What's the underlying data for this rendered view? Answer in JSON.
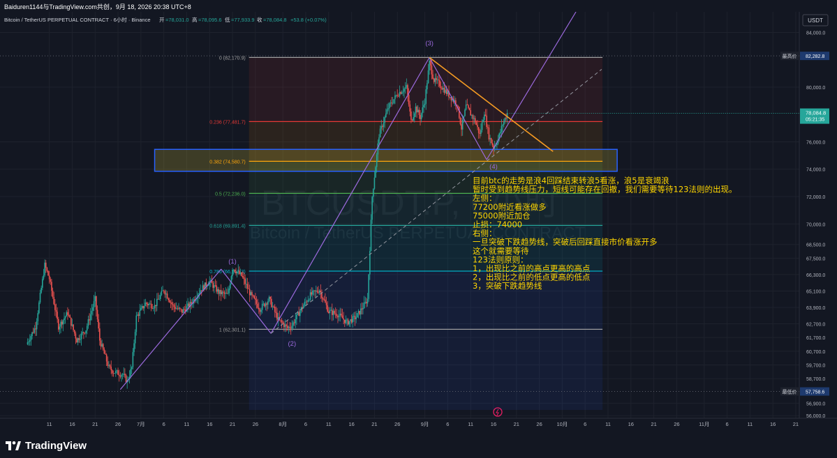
{
  "header": {
    "attribution": "Baiduren1144与TradingView.com共创，9月 18, 2026 20:38 UTC+8",
    "symbol": "Bitcoin / TetherUS PERPETUAL CONTRACT · 6小时 · Binance",
    "ohlc": {
      "open_label": "开",
      "open": "=78,031.0",
      "high_label": "高",
      "high": "=78,095.6",
      "low_label": "低",
      "low": "=77,933.9",
      "close_label": "收",
      "close": "=78,084.8",
      "change": "+53.8 (+0.07%)"
    }
  },
  "watermark": {
    "line1": "BTCUSDT.P, 6小时",
    "line2": "Bitcoin / TetherUS PERPETUAL CONTRACT"
  },
  "currency": "USDT",
  "footer": {
    "brand": "TradingView"
  },
  "colors": {
    "background": "#131722",
    "up": "#26a69a",
    "down": "#ef5350",
    "accent_purple": "#9c6ade",
    "trend_orange": "#f59b23",
    "annotation_yellow": "#ffd600",
    "box_blue": "#2962ff"
  },
  "chart_data": {
    "type": "candlestick",
    "ylim": [
      55800,
      85500
    ],
    "y_ticks": [
      {
        "label": "84,000.0",
        "value": 84000
      },
      {
        "label": "80,000.0",
        "value": 80000
      },
      {
        "label": "76,000.0",
        "value": 76000
      },
      {
        "label": "74,000.0",
        "value": 74000
      },
      {
        "label": "72,000.0",
        "value": 72000
      },
      {
        "label": "70,000.0",
        "value": 70000
      },
      {
        "label": "68,500.0",
        "value": 68500
      },
      {
        "label": "67,500.0",
        "value": 67500
      },
      {
        "label": "66,300.0",
        "value": 66300
      },
      {
        "label": "65,100.0",
        "value": 65100
      },
      {
        "label": "63,900.0",
        "value": 63900
      },
      {
        "label": "62,700.0",
        "value": 62700
      },
      {
        "label": "61,700.0",
        "value": 61700
      },
      {
        "label": "60,700.0",
        "value": 60700
      },
      {
        "label": "59,700.0",
        "value": 59700
      },
      {
        "label": "58,700.0",
        "value": 58700
      },
      {
        "label": "56,900.0",
        "value": 56900
      },
      {
        "label": "56,000.0",
        "value": 56000
      }
    ],
    "x_ticks": [
      {
        "label": "11",
        "day": 11
      },
      {
        "label": "16",
        "day": 16
      },
      {
        "label": "21",
        "day": 21
      },
      {
        "label": "26",
        "day": 26
      },
      {
        "label": "7月",
        "day": 31
      },
      {
        "label": "6",
        "day": 36
      },
      {
        "label": "11",
        "day": 41
      },
      {
        "label": "16",
        "day": 46
      },
      {
        "label": "21",
        "day": 51
      },
      {
        "label": "26",
        "day": 56
      },
      {
        "label": "8月",
        "day": 62
      },
      {
        "label": "6",
        "day": 67
      },
      {
        "label": "11",
        "day": 72
      },
      {
        "label": "16",
        "day": 77
      },
      {
        "label": "21",
        "day": 82
      },
      {
        "label": "26",
        "day": 87
      },
      {
        "label": "9月",
        "day": 93
      },
      {
        "label": "6",
        "day": 98
      },
      {
        "label": "11",
        "day": 103
      },
      {
        "label": "16",
        "day": 108
      },
      {
        "label": "21",
        "day": 113
      },
      {
        "label": "26",
        "day": 118
      },
      {
        "label": "10月",
        "day": 123
      },
      {
        "label": "6",
        "day": 128
      },
      {
        "label": "11",
        "day": 133
      },
      {
        "label": "16",
        "day": 138
      },
      {
        "label": "21",
        "day": 143
      },
      {
        "label": "26",
        "day": 148
      },
      {
        "label": "11月",
        "day": 154
      },
      {
        "label": "6",
        "day": 159
      },
      {
        "label": "11",
        "day": 164
      },
      {
        "label": "16",
        "day": 169
      },
      {
        "label": "21",
        "day": 174
      }
    ],
    "price_path": [
      [
        6,
        61200
      ],
      [
        8,
        62500
      ],
      [
        10,
        67000
      ],
      [
        11,
        66000
      ],
      [
        13,
        62500
      ],
      [
        15,
        63500
      ],
      [
        17,
        61500
      ],
      [
        19,
        62300
      ],
      [
        21,
        64500
      ],
      [
        22,
        61500
      ],
      [
        24,
        59500
      ],
      [
        25,
        59200
      ],
      [
        27,
        59000
      ],
      [
        28,
        58500
      ],
      [
        29,
        59500
      ],
      [
        30,
        63200
      ],
      [
        32,
        64200
      ],
      [
        34,
        64000
      ],
      [
        36,
        65200
      ],
      [
        38,
        64000
      ],
      [
        40,
        63600
      ],
      [
        42,
        64200
      ],
      [
        44,
        65200
      ],
      [
        46,
        65800
      ],
      [
        48,
        65000
      ],
      [
        50,
        64800
      ],
      [
        51,
        66800
      ],
      [
        53,
        66200
      ],
      [
        55,
        64800
      ],
      [
        57,
        63800
      ],
      [
        59,
        64500
      ],
      [
        61,
        63000
      ],
      [
        63,
        62400
      ],
      [
        64,
        62600
      ],
      [
        66,
        63800
      ],
      [
        68,
        64800
      ],
      [
        70,
        65200
      ],
      [
        72,
        63600
      ],
      [
        74,
        63400
      ],
      [
        76,
        62800
      ],
      [
        78,
        63200
      ],
      [
        80,
        64200
      ],
      [
        80.5,
        64500
      ],
      [
        81.5,
        72000
      ],
      [
        82.5,
        75000
      ],
      [
        83,
        76500
      ],
      [
        85,
        78500
      ],
      [
        87,
        79500
      ],
      [
        89,
        80000
      ],
      [
        90,
        77500
      ],
      [
        91,
        78500
      ],
      [
        92,
        77800
      ],
      [
        93,
        79000
      ],
      [
        94,
        81800
      ],
      [
        95,
        80500
      ],
      [
        96,
        80300
      ],
      [
        98,
        79500
      ],
      [
        100,
        78800
      ],
      [
        101,
        77000
      ],
      [
        102,
        78600
      ],
      [
        104,
        77500
      ],
      [
        105,
        76500
      ],
      [
        106,
        78200
      ],
      [
        107,
        76400
      ],
      [
        108,
        75600
      ],
      [
        109,
        76200
      ],
      [
        110,
        77300
      ],
      [
        111,
        78084.8
      ]
    ],
    "last_price": 78084.8,
    "fib_retracement": {
      "levels": [
        {
          "ratio": "0",
          "price": 82170.9,
          "label": "0 (82,170.9)",
          "color": "#a0a0a0"
        },
        {
          "ratio": "0.236",
          "price": 77481.7,
          "label": "0.236 (77,481.7)",
          "color": "#e53935"
        },
        {
          "ratio": "0.382",
          "price": 74580.7,
          "label": "0.382 (74,580.7)",
          "color": "#ff9800"
        },
        {
          "ratio": "0.5",
          "price": 72236.0,
          "label": "0.5 (72,236.0)",
          "color": "#4caf50"
        },
        {
          "ratio": "0.618",
          "price": 69891.4,
          "label": "0.618 (69,891.4)",
          "color": "#26a69a"
        },
        {
          "ratio": "0.786",
          "price": 66553.3,
          "label": "0.786 (66,553.3)",
          "color": "#00bcd4"
        },
        {
          "ratio": "1",
          "price": 62301.1,
          "label": "1 (62,301.1)",
          "color": "#9e9e9e"
        }
      ]
    },
    "wave_labels": [
      {
        "label": "(1)",
        "day": 51,
        "price": 67100
      },
      {
        "label": "(2)",
        "day": 64,
        "price": 61100
      },
      {
        "label": "(3)",
        "day": 94,
        "price": 83050
      },
      {
        "label": "(4)",
        "day": 108,
        "price": 74050
      }
    ],
    "price_marks": [
      {
        "tag": "最高价",
        "value": "82,282.8",
        "price": 82282.8
      },
      {
        "tag": "最低价",
        "value": "57,758.6",
        "price": 57758.6
      }
    ],
    "current": {
      "price": "78,084.8",
      "countdown": "05:21:35"
    },
    "annotation": [
      "目前btc的走势是浪4回踩结束转浪5看涨，浪5是衰竭浪",
      "暂时受到趋势线压力，短线可能存在回撤，我们需要等待123法则的出现。",
      "左侧：",
      "77200附近看涨做多",
      "75000附近加仓",
      "止损：74000",
      "右侧：",
      "一旦突破下跌趋势线，突破后回踩直接市价看涨开多",
      "这个就需要等待",
      "123法则原则：",
      "1，出现比之前的高点更高的高点",
      "2，出现比之前的低点更高的低点",
      "3，突破下跌趋势线"
    ]
  }
}
